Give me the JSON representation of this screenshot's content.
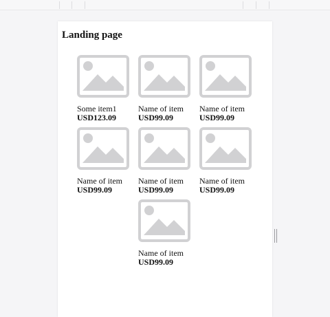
{
  "page": {
    "title": "Landing page"
  },
  "items": [
    {
      "name": "Some item1",
      "price": "USD123.09"
    },
    {
      "name": "Name of item",
      "price": "USD99.09"
    },
    {
      "name": "Name of item",
      "price": "USD99.09"
    },
    {
      "name": "Name of item",
      "price": "USD99.09"
    },
    {
      "name": "Name of item",
      "price": "USD99.09"
    },
    {
      "name": "Name of item",
      "price": "USD99.09"
    },
    {
      "name": "Name of item",
      "price": "USD99.09"
    }
  ],
  "icons": {
    "placeholder": "image-placeholder-icon",
    "resize": "resize-handle-icon"
  },
  "colors": {
    "placeholder_gray": "#d1d1d3",
    "page_bg": "#ffffff",
    "canvas_bg": "#f5f5f7"
  }
}
